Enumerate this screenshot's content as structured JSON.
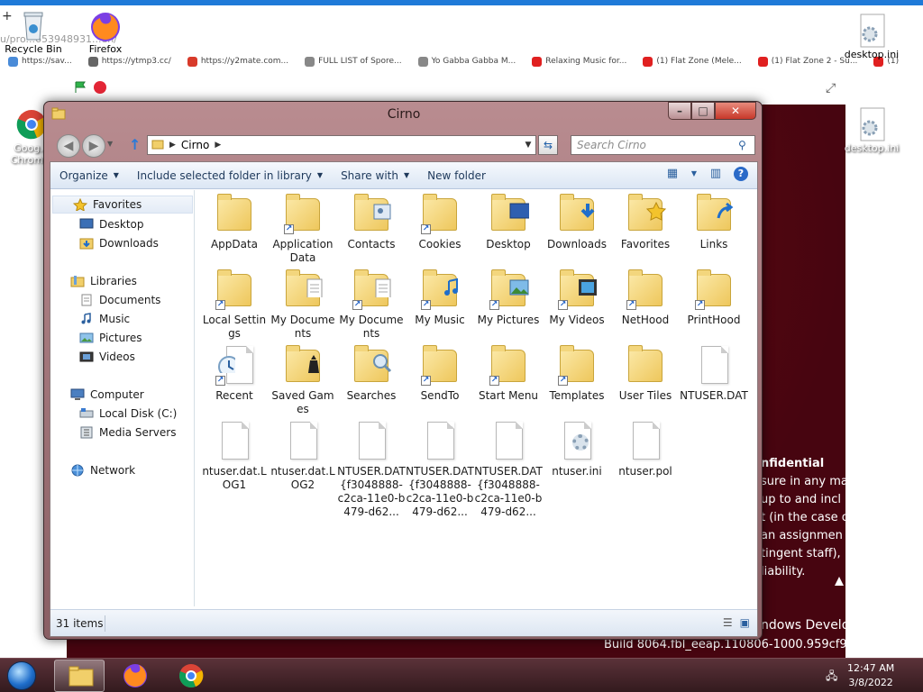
{
  "browser": {
    "url": "u/pro...653948931...en/",
    "new_tab_symbol": "+",
    "bookmarks": [
      {
        "label": "https://sav...",
        "color": "#4a8bd8"
      },
      {
        "label": "https://ytmp3.cc/",
        "color": "#666666"
      },
      {
        "label": "https://y2mate.com...",
        "color": "#d83a2a"
      },
      {
        "label": "FULL LIST of Spore...",
        "color": "#888888"
      },
      {
        "label": "Yo Gabba Gabba M...",
        "color": "#888888"
      },
      {
        "label": "Relaxing Music for...",
        "color": "#e02020"
      },
      {
        "label": "(1) Flat Zone (Mele...",
        "color": "#e02020"
      },
      {
        "label": "(1) Flat Zone 2 - Su...",
        "color": "#e02020"
      },
      {
        "label": "(1)",
        "color": "#e02020"
      }
    ]
  },
  "desktop": {
    "icons": [
      {
        "label": "Recycle Bin"
      },
      {
        "label": "Firefox"
      },
      {
        "label": "Goog... Chrom..."
      },
      {
        "label": "desktop.ini"
      },
      {
        "label": "desktop.ini"
      }
    ],
    "background_text": {
      "heading": "nfidential",
      "lines": [
        "sure in any ma",
        "up to and incl",
        "t (in the case o",
        "an assignmen",
        "tingent staff),",
        "liability."
      ],
      "windows_line": "ndows Develo",
      "build": "Build 8064.fbl_eeap.110806-1000.959cf9"
    }
  },
  "window": {
    "title": "Cirno",
    "address": [
      "Cirno"
    ],
    "search_placeholder": "Search Cirno",
    "commands": [
      "Organize",
      "Include selected folder in library",
      "Share with",
      "New folder"
    ],
    "nav": {
      "favorites": {
        "label": "Favorites",
        "items": [
          "Desktop",
          "Downloads"
        ]
      },
      "libraries": {
        "label": "Libraries",
        "items": [
          "Documents",
          "Music",
          "Pictures",
          "Videos"
        ]
      },
      "computer": {
        "label": "Computer",
        "items": [
          "Local Disk (C:)",
          "Media Servers"
        ]
      },
      "network": {
        "label": "Network"
      }
    },
    "files": [
      {
        "name": "AppData",
        "kind": "folder",
        "shortcut": false
      },
      {
        "name": "Application Data",
        "kind": "folder",
        "shortcut": true
      },
      {
        "name": "Contacts",
        "kind": "folder-contacts",
        "shortcut": false
      },
      {
        "name": "Cookies",
        "kind": "folder",
        "shortcut": true
      },
      {
        "name": "Desktop",
        "kind": "folder-desktop",
        "shortcut": false
      },
      {
        "name": "Downloads",
        "kind": "folder-downloads",
        "shortcut": false
      },
      {
        "name": "Favorites",
        "kind": "folder-favorites",
        "shortcut": false
      },
      {
        "name": "Links",
        "kind": "folder-links",
        "shortcut": false
      },
      {
        "name": "Local Settings",
        "kind": "folder",
        "shortcut": true
      },
      {
        "name": "My Documents",
        "kind": "folder-documents",
        "shortcut": false
      },
      {
        "name": "My Documents",
        "kind": "folder-documents",
        "shortcut": true
      },
      {
        "name": "My Music",
        "kind": "folder-music",
        "shortcut": true
      },
      {
        "name": "My Pictures",
        "kind": "folder-pictures",
        "shortcut": true
      },
      {
        "name": "My Videos",
        "kind": "folder-videos",
        "shortcut": true
      },
      {
        "name": "NetHood",
        "kind": "folder",
        "shortcut": true
      },
      {
        "name": "PrintHood",
        "kind": "folder",
        "shortcut": true
      },
      {
        "name": "Recent",
        "kind": "recent",
        "shortcut": true
      },
      {
        "name": "Saved Games",
        "kind": "folder-games",
        "shortcut": false
      },
      {
        "name": "Searches",
        "kind": "folder-searches",
        "shortcut": false
      },
      {
        "name": "SendTo",
        "kind": "folder",
        "shortcut": true
      },
      {
        "name": "Start Menu",
        "kind": "folder",
        "shortcut": true
      },
      {
        "name": "Templates",
        "kind": "folder",
        "shortcut": true
      },
      {
        "name": "User Tiles",
        "kind": "folder",
        "shortcut": false
      },
      {
        "name": "NTUSER.DAT",
        "kind": "file",
        "shortcut": false
      },
      {
        "name": "ntuser.dat.LOG1",
        "kind": "file",
        "shortcut": false
      },
      {
        "name": "ntuser.dat.LOG2",
        "kind": "file",
        "shortcut": false
      },
      {
        "name": "NTUSER.DAT{f3048888-c2ca-11e0-b479-d62...",
        "kind": "file",
        "shortcut": false
      },
      {
        "name": "NTUSER.DAT{f3048888-c2ca-11e0-b479-d62...",
        "kind": "file",
        "shortcut": false
      },
      {
        "name": "NTUSER.DAT{f3048888-c2ca-11e0-b479-d62...",
        "kind": "file",
        "shortcut": false
      },
      {
        "name": "ntuser.ini",
        "kind": "file-ini",
        "shortcut": false
      },
      {
        "name": "ntuser.pol",
        "kind": "file",
        "shortcut": false
      }
    ],
    "status": "31 items"
  },
  "taskbar": {
    "time": "12:47 AM",
    "date": "3/8/2022"
  },
  "colors": {
    "accent": "#1f7ad8",
    "folder": "#eec75c",
    "taskbar": "#331a1e",
    "wallpaper": "#470510"
  }
}
